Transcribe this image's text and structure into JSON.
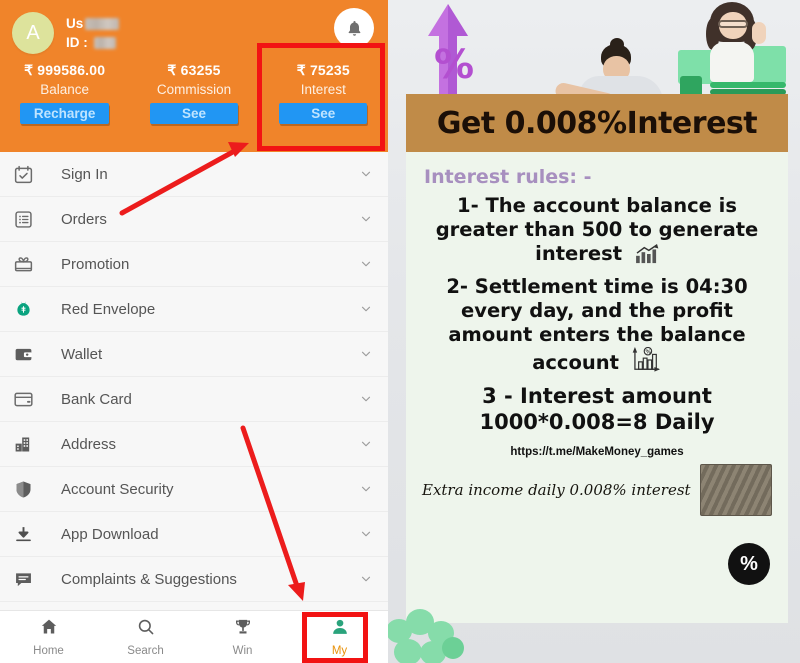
{
  "app": {
    "account": {
      "avatar_initial": "A",
      "name_prefix": "Us",
      "id_label": "ID :",
      "name_redacted": true,
      "id_redacted": true
    },
    "notification_icon": "bell-icon",
    "stats": [
      {
        "amount": "₹ 999586.00",
        "label": "Balance",
        "action": "Recharge"
      },
      {
        "amount": "₹ 63255",
        "label": "Commission",
        "action": "See"
      },
      {
        "amount": "₹ 75235",
        "label": "Interest",
        "action": "See"
      }
    ],
    "menu": [
      {
        "label": "Sign In",
        "icon": "calendar-check-icon"
      },
      {
        "label": "Orders",
        "icon": "list-box-icon"
      },
      {
        "label": "Promotion",
        "icon": "gift-icon"
      },
      {
        "label": "Red Envelope",
        "icon": "money-bag-icon"
      },
      {
        "label": "Wallet",
        "icon": "wallet-icon"
      },
      {
        "label": "Bank Card",
        "icon": "credit-card-icon"
      },
      {
        "label": "Address",
        "icon": "building-icon"
      },
      {
        "label": "Account Security",
        "icon": "shield-icon"
      },
      {
        "label": "App Download",
        "icon": "download-icon"
      },
      {
        "label": "Complaints & Suggestions",
        "icon": "chat-bubble-icon"
      }
    ],
    "tabs": [
      {
        "label": "Home",
        "icon": "home-icon",
        "active": false
      },
      {
        "label": "Search",
        "icon": "search-icon",
        "active": false
      },
      {
        "label": "Win",
        "icon": "trophy-icon",
        "active": false
      },
      {
        "label": "My",
        "icon": "person-icon",
        "active": true
      }
    ]
  },
  "promo": {
    "title": "Get 0.008%Interest",
    "rules_heading": "Interest rules: -",
    "rules": [
      "1- The account balance is greater than 500 to generate interest",
      "2- Settlement time is 04:30 every day, and the profit amount enters the balance account",
      "3 - Interest amount 1000*0.008=8 Daily"
    ],
    "url": "https://t.me/MakeMoney_games",
    "footer_text": "Extra income daily 0.008% interest",
    "seal_text": "%"
  },
  "annotations": {
    "colors": {
      "highlight": "#f21313",
      "header": "#f0842a",
      "button": "#2196f3",
      "tab_active": "#e8920b"
    },
    "boxes": [
      {
        "name": "interest-card-highlight",
        "target": "Interest"
      },
      {
        "name": "my-tab-highlight",
        "target": "My"
      }
    ],
    "arrows": [
      {
        "name": "arrow-to-interest",
        "points_to": "Interest See button"
      },
      {
        "name": "arrow-to-my-tab",
        "points_to": "My tab"
      }
    ]
  }
}
